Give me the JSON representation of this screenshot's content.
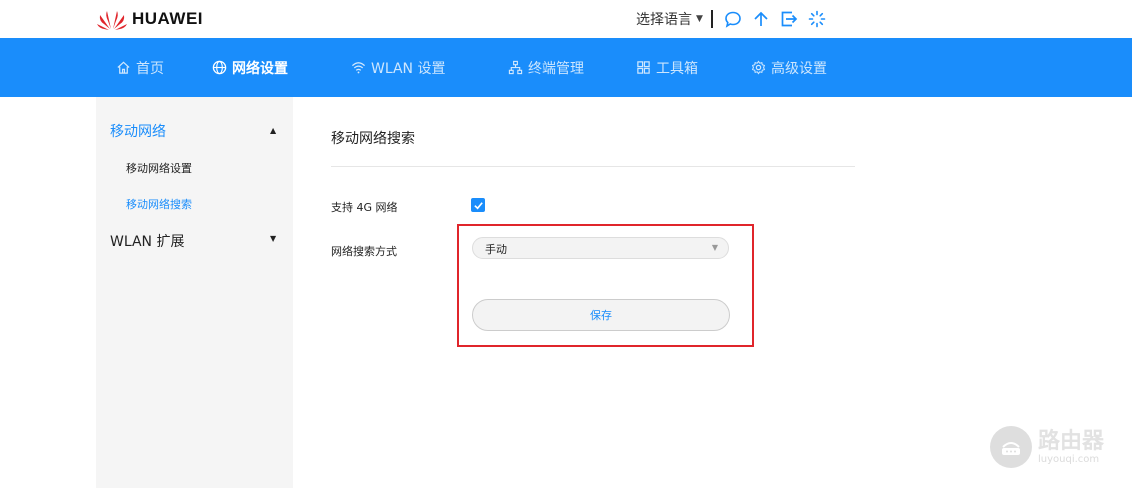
{
  "header": {
    "brand": "HUAWEI",
    "brand_color": "#e0252b",
    "language_label": "选择语言",
    "icons": [
      "chat-bubble-icon",
      "upload-arrow-icon",
      "logout-icon",
      "loading-spinner-icon"
    ]
  },
  "nav": {
    "accent": "#1a8dfb",
    "items": [
      {
        "label": "首页",
        "icon": "home-icon",
        "active": false
      },
      {
        "label": "网络设置",
        "icon": "globe-icon",
        "active": true
      },
      {
        "label": "WLAN 设置",
        "icon": "wifi-icon",
        "active": false
      },
      {
        "label": "终端管理",
        "icon": "network-topology-icon",
        "active": false
      },
      {
        "label": "工具箱",
        "icon": "grid-icon",
        "active": false
      },
      {
        "label": "高级设置",
        "icon": "gear-icon",
        "active": false
      }
    ]
  },
  "sidebar": {
    "groups": [
      {
        "label": "移动网络",
        "expanded": true,
        "items": [
          {
            "label": "移动网络设置",
            "active": false
          },
          {
            "label": "移动网络搜索",
            "active": true
          }
        ]
      },
      {
        "label": "WLAN 扩展",
        "expanded": false
      }
    ]
  },
  "main": {
    "title": "移动网络搜索",
    "support_4g_label": "支持 4G 网络",
    "support_4g_checked": true,
    "search_mode_label": "网络搜索方式",
    "search_mode_value": "手动",
    "save_label": "保存"
  },
  "watermark": {
    "main": "路由器",
    "sub": "luyouqi.com"
  }
}
